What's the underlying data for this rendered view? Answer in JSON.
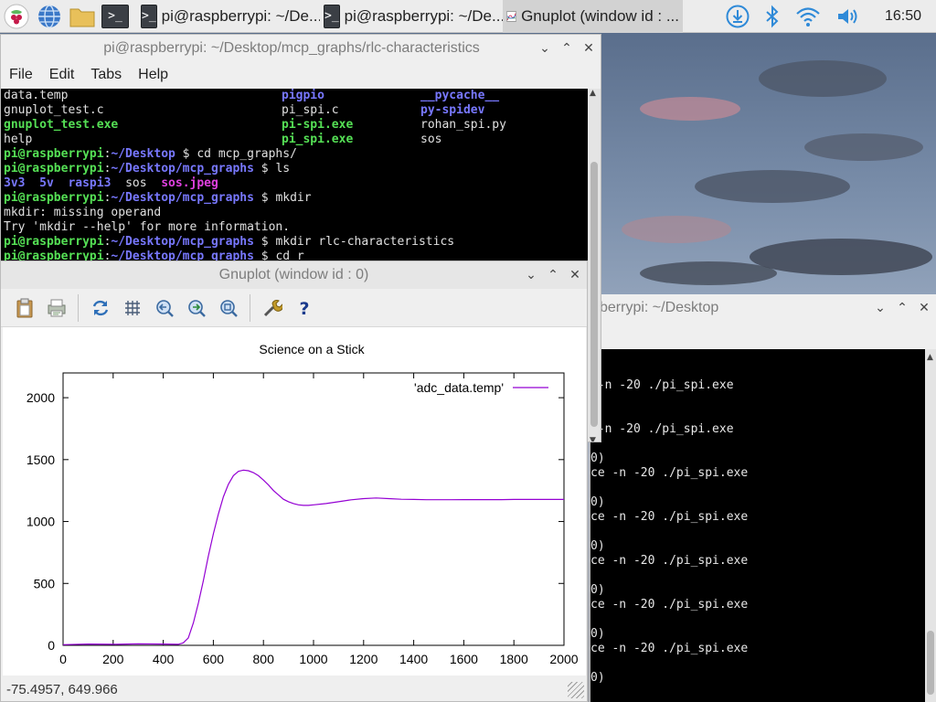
{
  "taskbar": {
    "tasks": [
      {
        "label": "pi@raspberrypi: ~/De..."
      },
      {
        "label": "pi@raspberrypi: ~/De..."
      },
      {
        "label": "Gnuplot (window id : ..."
      }
    ],
    "clock": "16:50"
  },
  "terminal_main": {
    "title": "pi@raspberrypi: ~/Desktop/mcp_graphs/rlc-characteristics",
    "menu": [
      "File",
      "Edit",
      "Tabs",
      "Help"
    ],
    "listing": [
      [
        "data.temp",
        "pigpio",
        "__pycache__"
      ],
      [
        "gnuplot_test.c",
        "pi_spi.c",
        "py-spidev"
      ],
      [
        "gnuplot_test.exe",
        "pi-spi.exe",
        "rohan_spi.py"
      ],
      [
        "help",
        "pi_spi.exe",
        "sos"
      ]
    ],
    "prompt_user": "pi@raspberrypi",
    "lines": [
      {
        "dir": "~/Desktop",
        "cmd": "cd mcp_graphs/"
      },
      {
        "dir": "~/Desktop/mcp_graphs",
        "cmd": "ls"
      },
      {
        "dir": "~/Desktop/mcp_graphs",
        "cmd": "mkdir"
      },
      {
        "dir": "~/Desktop/mcp_graphs",
        "cmd": "mkdir rlc-characteristics"
      },
      {
        "dir": "~/Desktop/mcp_graphs",
        "cmd": "cd r"
      }
    ],
    "ls_output": [
      "3v3",
      "5v",
      "raspi3",
      "sos",
      "sos.jpeg"
    ],
    "mkdir_error": "mkdir: missing operand",
    "mkdir_hint": "Try 'mkdir --help' for more information."
  },
  "terminal_back": {
    "title": "berrypi: ~/Desktop",
    "lines": [
      "",
      "",
      " -n -20 ./pi_spi.exe",
      "",
      "",
      " -n -20 ./pi_spi.exe",
      "",
      "0)",
      "ce -n -20 ./pi_spi.exe",
      "",
      "0)",
      "ce -n -20 ./pi_spi.exe",
      "",
      "0)",
      "ce -n -20 ./pi_spi.exe",
      "",
      "0)",
      "ce -n -20 ./pi_spi.exe",
      "",
      "0)",
      "ce -n -20 ./pi_spi.exe",
      "",
      "0)"
    ]
  },
  "gnuplot": {
    "title": "Gnuplot (window id : 0)",
    "status": "-75.4957,  649.966",
    "toolbar_icons": [
      "clipboard-icon",
      "print-icon",
      "replot-icon",
      "grid-icon",
      "zoom-previous-icon",
      "zoom-next-icon",
      "autoscale-icon",
      "config-icon",
      "help-icon"
    ]
  },
  "chart_data": {
    "type": "line",
    "title": "Science on a Stick",
    "xlabel": "",
    "ylabel": "",
    "xlim": [
      0,
      2000
    ],
    "ylim": [
      0,
      2200
    ],
    "xticks": [
      0,
      200,
      400,
      600,
      800,
      1000,
      1200,
      1400,
      1600,
      1800,
      2000
    ],
    "yticks": [
      0,
      500,
      1000,
      1500,
      2000
    ],
    "grid": false,
    "legend": "top-right",
    "series": [
      {
        "name": "'adc_data.temp'",
        "color": "#9400d3",
        "x": [
          0,
          100,
          200,
          300,
          400,
          460,
          480,
          500,
          520,
          540,
          560,
          580,
          600,
          620,
          640,
          660,
          680,
          700,
          720,
          740,
          760,
          780,
          800,
          820,
          840,
          860,
          880,
          900,
          920,
          940,
          960,
          980,
          1000,
          1050,
          1100,
          1150,
          1200,
          1250,
          1300,
          1350,
          1400,
          1450,
          1500,
          1550,
          1600,
          1650,
          1700,
          1750,
          1800,
          1850,
          1900,
          1950,
          2000
        ],
        "values": [
          5,
          10,
          8,
          12,
          10,
          8,
          20,
          60,
          180,
          340,
          520,
          720,
          900,
          1060,
          1200,
          1300,
          1370,
          1405,
          1415,
          1410,
          1395,
          1370,
          1335,
          1295,
          1250,
          1215,
          1180,
          1160,
          1145,
          1135,
          1130,
          1130,
          1135,
          1145,
          1160,
          1175,
          1185,
          1190,
          1185,
          1180,
          1178,
          1176,
          1176,
          1176,
          1177,
          1177,
          1177,
          1177,
          1178,
          1178,
          1178,
          1178,
          1178
        ]
      }
    ]
  }
}
